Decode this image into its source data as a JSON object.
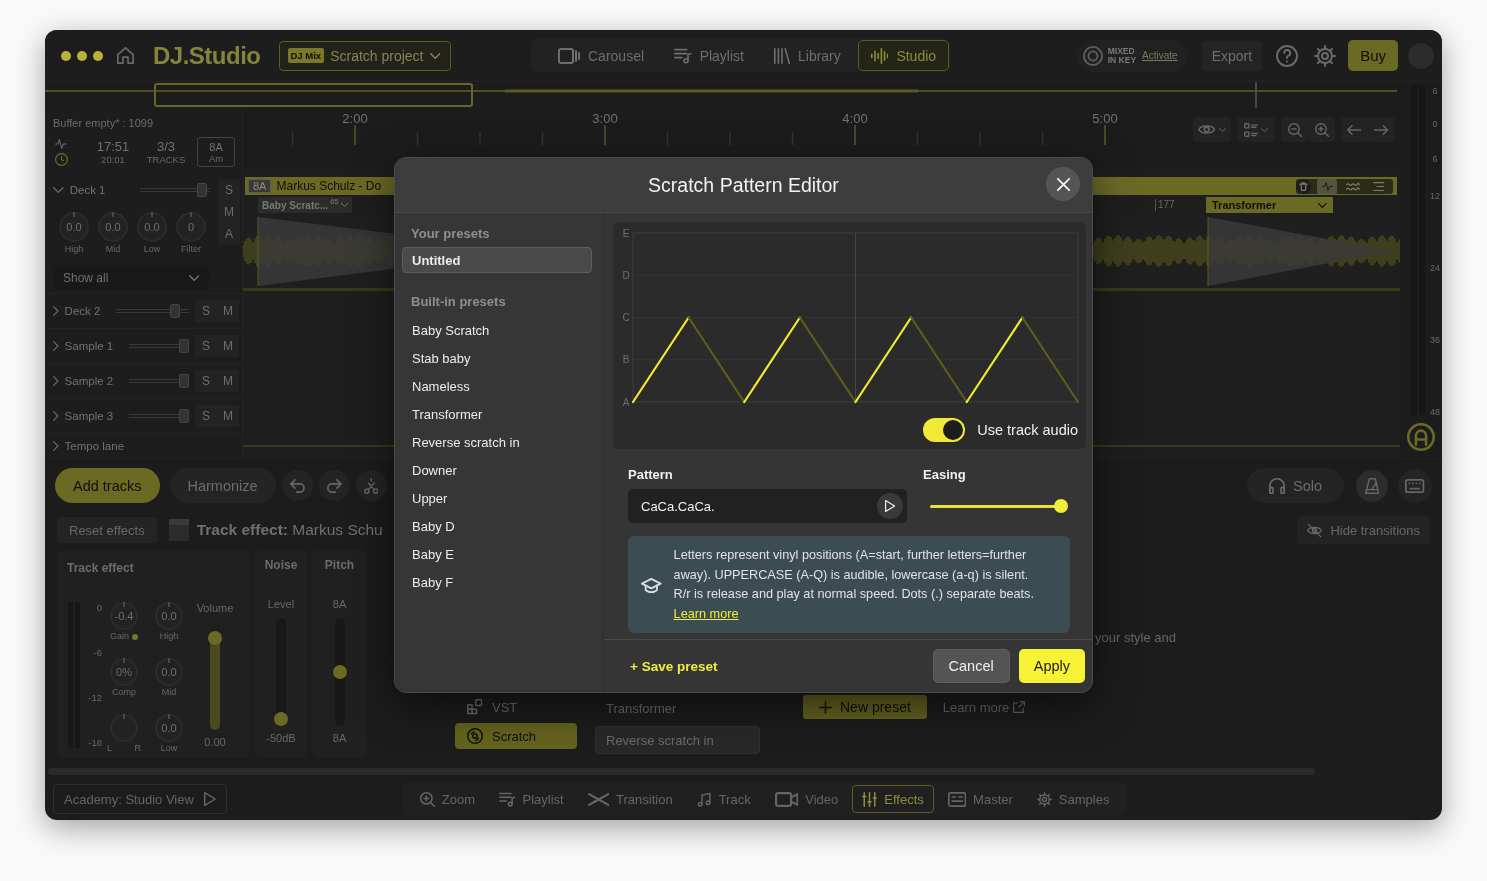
{
  "app_bar": {
    "logo": "DJ.Studio",
    "project": {
      "badge": "DJ Mix",
      "name": "Scratch project"
    },
    "nav_tabs": [
      {
        "label": "Carousel",
        "selected": false
      },
      {
        "label": "Playlist",
        "selected": false
      },
      {
        "label": "Library",
        "selected": false
      },
      {
        "label": "Studio",
        "selected": true
      }
    ],
    "partner_logo": [
      "MIXED",
      "IN KEY"
    ],
    "activate": "Activate",
    "export": "Export",
    "buy": "Buy"
  },
  "timeline": {
    "buffer": "Buffer empty* : 1099",
    "stats": [
      {
        "value": "17:51",
        "caption": "20:01"
      },
      {
        "value": "3/3",
        "caption": "TRACKS"
      }
    ],
    "key": {
      "value": "8A",
      "caption": "Am"
    },
    "time_marks": [
      "2:00",
      "3:00",
      "4:00",
      "5:00"
    ],
    "clip_left": {
      "key": "8A",
      "title": "Markus Schulz - Do",
      "scratch": "Baby Scratc...",
      "bar": "65"
    },
    "clip_right": {
      "bar": "177",
      "scratch": "Transformer"
    },
    "meter_scale": [
      "6",
      "0",
      "6",
      "12",
      "24",
      "36",
      "48"
    ]
  },
  "tracks": [
    {
      "name": "Deck 1",
      "expanded": true,
      "level": 0.95,
      "buttons": [
        "S",
        "M",
        "A"
      ],
      "knobs": [
        {
          "value": "0.0",
          "label": "High"
        },
        {
          "value": "0.0",
          "label": "Mid"
        },
        {
          "value": "0.0",
          "label": "Low"
        },
        {
          "value": "0",
          "label": "Filter"
        }
      ],
      "filter": "Show all"
    },
    {
      "name": "Deck 2",
      "expanded": false,
      "level": 0.85,
      "buttons": [
        "S",
        "M"
      ]
    },
    {
      "name": "Sample 1",
      "expanded": false,
      "level": 1,
      "buttons": [
        "S",
        "M"
      ]
    },
    {
      "name": "Sample 2",
      "expanded": false,
      "level": 1,
      "buttons": [
        "S",
        "M"
      ]
    },
    {
      "name": "Sample 3",
      "expanded": false,
      "level": 1,
      "buttons": [
        "S",
        "M"
      ]
    },
    {
      "name": "Tempo lane",
      "expanded": false
    }
  ],
  "toolbar": {
    "add_tracks": "Add tracks",
    "harmonize": "Harmonize",
    "solo": "Solo"
  },
  "effects": {
    "reset": "Reset effects",
    "title": "**Track effect:** Markus Schu",
    "hide_transitions": "Hide transitions",
    "track_effect": {
      "heading": "Track effect",
      "meter_scale": [
        "0",
        "-6",
        "-12",
        "-18"
      ],
      "knobs": [
        {
          "kind": "value",
          "value": "-0.4",
          "label": "Gain",
          "indicator": true
        },
        {
          "kind": "value",
          "value": "0%",
          "label": "Comp",
          "indicator": false
        },
        {
          "kind": "pan",
          "left": "L",
          "right": "R"
        },
        {
          "kind": "value",
          "value": "0.0",
          "label": "High",
          "indicator": false
        },
        {
          "kind": "value",
          "value": "0.0",
          "label": "Mid",
          "indicator": false
        },
        {
          "kind": "value",
          "value": "0.0",
          "label": "Low",
          "indicator": false
        }
      ],
      "volume": {
        "label": "Volume",
        "value": "0.00",
        "level": 0.9
      }
    },
    "noise": {
      "heading": "Noise",
      "label": "Level",
      "value": "-50dB",
      "level": 0
    },
    "pitch": {
      "heading": "Pitch",
      "label": "8A",
      "value": "8A",
      "level": 0.5
    },
    "types": [
      {
        "label": "VST",
        "selected": false
      },
      {
        "label": "Scratch",
        "selected": true
      }
    ],
    "presets": [
      {
        "label": "Transformer",
        "selected": false
      },
      {
        "label": "Reverse scratch in",
        "selected": true
      }
    ],
    "new_preset": "New preset",
    "learn_more": "Learn more",
    "description": "your style and"
  },
  "bottom_nav": {
    "academy": "Academy: Studio View",
    "tabs": [
      {
        "label": "Zoom",
        "selected": false
      },
      {
        "label": "Playlist",
        "selected": false
      },
      {
        "label": "Transition",
        "selected": false
      },
      {
        "label": "Track",
        "selected": false
      },
      {
        "label": "Video",
        "selected": false
      },
      {
        "label": "Effects",
        "selected": true
      },
      {
        "label": "Master",
        "selected": false
      },
      {
        "label": "Samples",
        "selected": false
      }
    ]
  },
  "editor": {
    "title": "Scratch Pattern Editor",
    "your_presets": {
      "heading": "Your presets",
      "items": [
        {
          "label": "Untitled",
          "selected": true
        }
      ]
    },
    "built_in_presets": {
      "heading": "Built-in presets",
      "items": [
        {
          "label": "Baby Scratch",
          "selected": false
        },
        {
          "label": "Stab baby",
          "selected": false
        },
        {
          "label": "Nameless",
          "selected": false
        },
        {
          "label": "Transformer",
          "selected": false
        },
        {
          "label": "Reverse scratch in",
          "selected": false
        },
        {
          "label": "Downer",
          "selected": false
        },
        {
          "label": "Upper",
          "selected": false
        },
        {
          "label": "Baby D",
          "selected": false
        },
        {
          "label": "Baby E",
          "selected": false
        },
        {
          "label": "Baby F",
          "selected": false
        }
      ]
    },
    "graph": {
      "y_labels": [
        "E",
        "D",
        "C",
        "B",
        "A"
      ]
    },
    "use_track_audio": {
      "label": "Use track audio",
      "on": true
    },
    "pattern": {
      "label": "Pattern",
      "value": "CaCa.CaCa."
    },
    "easing": {
      "label": "Easing",
      "level": 0.96
    },
    "info": {
      "text": "Letters represent vinyl positions (A=start, further letters=further away). UPPERCASE (A-Q) is audible, lowercase (a-q) is silent. R/r is release and play at normal speed. Dots (.) separate beats.",
      "link": "Learn more"
    },
    "save_preset": "+ Save preset",
    "buttons": [
      {
        "label": "Cancel",
        "kind": "secondary"
      },
      {
        "label": "Apply",
        "kind": "primary"
      }
    ]
  }
}
